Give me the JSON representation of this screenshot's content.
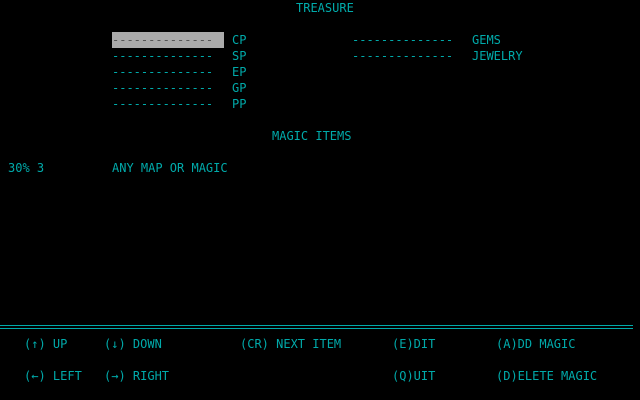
{
  "title": "TREASURE",
  "coins": [
    {
      "field": "--------------",
      "label": "CP",
      "selected": true
    },
    {
      "field": "--------------",
      "label": "SP",
      "selected": false
    },
    {
      "field": "--------------",
      "label": "EP",
      "selected": false
    },
    {
      "field": "--------------",
      "label": "GP",
      "selected": false
    },
    {
      "field": "--------------",
      "label": "PP",
      "selected": false
    }
  ],
  "valuables": [
    {
      "field": "--------------",
      "label": "GEMS"
    },
    {
      "field": "--------------",
      "label": "JEWELRY"
    }
  ],
  "magic_items": {
    "heading": "MAGIC ITEMS",
    "rows": [
      {
        "chance": "30% 3",
        "description": "ANY MAP OR MAGIC"
      }
    ]
  },
  "commands": {
    "up": "(↑) UP",
    "down": "(↓) DOWN",
    "next_item": "(CR) NEXT ITEM",
    "edit": "(E)DIT",
    "add_magic": "(A)DD MAGIC",
    "left": "(←) LEFT",
    "right": "(→) RIGHT",
    "quit": "(Q)UIT",
    "delete_magic": "(D)ELETE MAGIC"
  },
  "colors": {
    "background": "#000000",
    "text": "#00AAAA",
    "highlight": "#AAAAAA"
  }
}
